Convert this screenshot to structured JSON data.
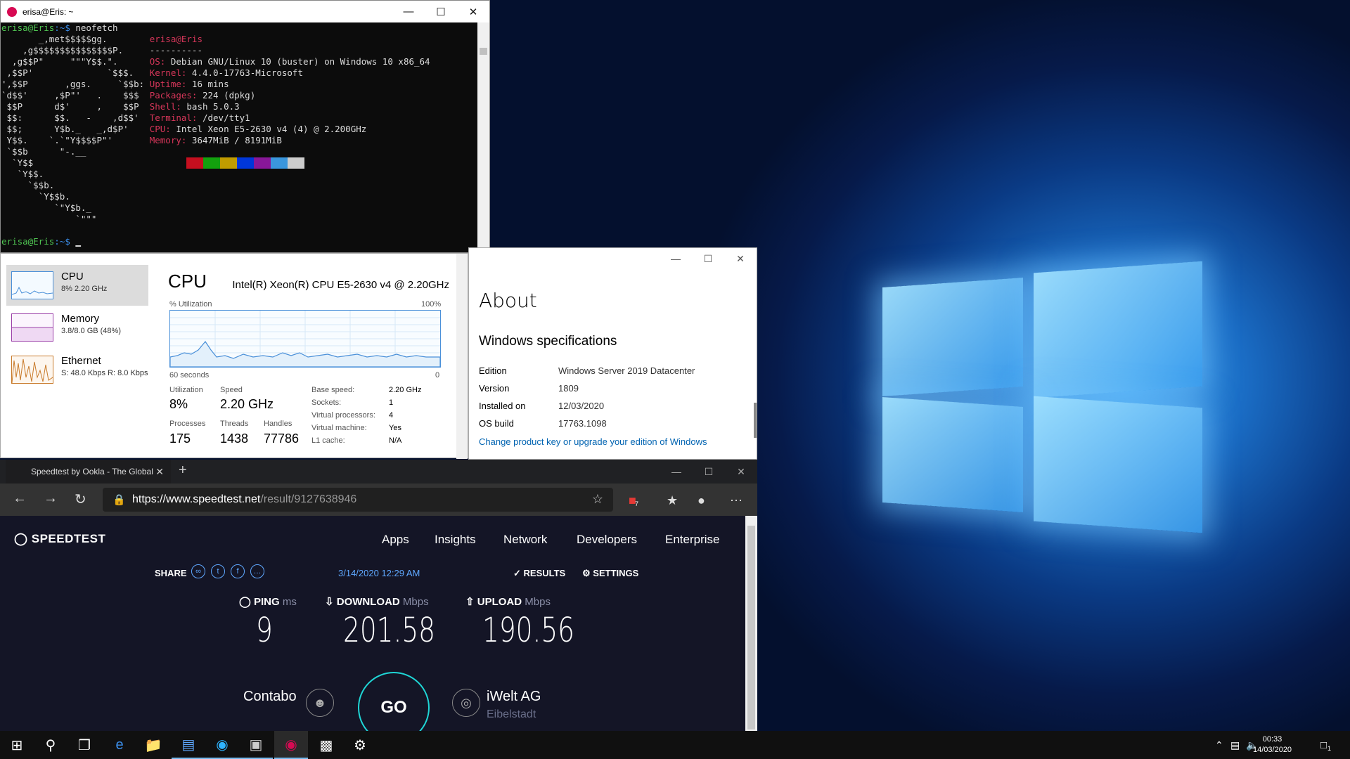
{
  "terminal": {
    "title": "erisa@Eris: ~",
    "prompt_user": "erisa@Eris",
    "prompt_path": ":~$",
    "command": " neofetch",
    "user_host": "erisa@Eris",
    "separator": "----------",
    "info": [
      {
        "key": "OS:",
        "value": " Debian GNU/Linux 10 (buster) on Windows 10 x86_64"
      },
      {
        "key": "Kernel:",
        "value": " 4.4.0-17763-Microsoft"
      },
      {
        "key": "Uptime:",
        "value": " 16 mins"
      },
      {
        "key": "Packages:",
        "value": " 224 (dpkg)"
      },
      {
        "key": "Shell:",
        "value": " bash 5.0.3"
      },
      {
        "key": "Terminal:",
        "value": " /dev/tty1"
      },
      {
        "key": "CPU:",
        "value": " Intel Xeon E5-2630 v4 (4) @ 2.200GHz"
      },
      {
        "key": "Memory:",
        "value": " 3647MiB / 8191MiB"
      }
    ],
    "ascii": [
      "       _,met$$$$$gg.",
      "    ,g$$$$$$$$$$$$$$$P.",
      "  ,g$$P\"     \"\"\"Y$$.\".",
      " ,$$P'              `$$$.",
      "',$$P       ,ggs.     `$$b:",
      "`d$$'     ,$P\"'   .    $$$",
      " $$P      d$'     ,    $$P",
      " $$:      $$.   -    ,d$$'",
      " $$;      Y$b._   _,d$P'",
      " Y$$.    `.`\"Y$$$$P\"'",
      " `$$b      \"-.__",
      "  `Y$$",
      "   `Y$$.",
      "     `$$b.",
      "       `Y$$b.",
      "          `\"Y$b._",
      "              `\"\"\""
    ],
    "swatches": [
      "#0c0c0c",
      "#c50f1f",
      "#13a10e",
      "#c19c00",
      "#0037da",
      "#881798",
      "#3a96dd",
      "#cccccc"
    ]
  },
  "taskmanager": {
    "sidebar": [
      {
        "name": "CPU",
        "sub": "8% 2.20 GHz"
      },
      {
        "name": "Memory",
        "sub": "3.8/8.0 GB (48%)"
      },
      {
        "name": "Ethernet",
        "sub": "S: 48.0 Kbps R: 8.0 Kbps"
      }
    ],
    "heading": "CPU",
    "cpu_name": "Intel(R) Xeon(R) CPU E5-2630 v4 @ 2.20GHz",
    "util_label": "% Utilization",
    "util_max": "100%",
    "time_label": "60 seconds",
    "time_zero": "0",
    "stats": {
      "utilization_label": "Utilization",
      "utilization": "8%",
      "speed_label": "Speed",
      "speed": "2.20 GHz",
      "processes_label": "Processes",
      "processes": "175",
      "threads_label": "Threads",
      "threads": "1438",
      "handles_label": "Handles",
      "handles": "77786"
    },
    "specs": [
      {
        "k": "Base speed:",
        "v": "2.20 GHz"
      },
      {
        "k": "Sockets:",
        "v": "1"
      },
      {
        "k": "Virtual processors:",
        "v": "4"
      },
      {
        "k": "Virtual machine:",
        "v": "Yes"
      },
      {
        "k": "L1 cache:",
        "v": "N/A"
      }
    ]
  },
  "about": {
    "title": "About",
    "section": "Windows specifications",
    "rows": [
      {
        "k": "Edition",
        "v": "Windows Server 2019 Datacenter"
      },
      {
        "k": "Version",
        "v": "1809"
      },
      {
        "k": "Installed on",
        "v": "12/03/2020"
      },
      {
        "k": "OS build",
        "v": "17763.1098"
      }
    ],
    "link": "Change product key or upgrade your edition of Windows"
  },
  "browser": {
    "tab_title": "Speedtest by Ookla - The Global",
    "url_host": "https://www.speedtest.net",
    "url_path": "/result/9127638946",
    "ext_badge": "7",
    "logo": "SPEEDTEST",
    "nav": [
      "Apps",
      "Insights",
      "Network",
      "Developers",
      "Enterprise"
    ],
    "share_label": "SHARE",
    "date": "3/14/2020 12:29 AM",
    "results_label": "RESULTS",
    "settings_label": "SETTINGS",
    "ping_label": "PING",
    "ping_unit": "ms",
    "ping": "9",
    "download_label": "DOWNLOAD",
    "download_unit": "Mbps",
    "download": "201.58",
    "upload_label": "UPLOAD",
    "upload_unit": "Mbps",
    "upload": "190.56",
    "go": "GO",
    "isp": "Contabo",
    "server": "iWelt AG",
    "server_city": "Eibelstadt"
  },
  "taskbar": {
    "time": "00:33",
    "date": "14/03/2020",
    "notification_count": "1"
  }
}
